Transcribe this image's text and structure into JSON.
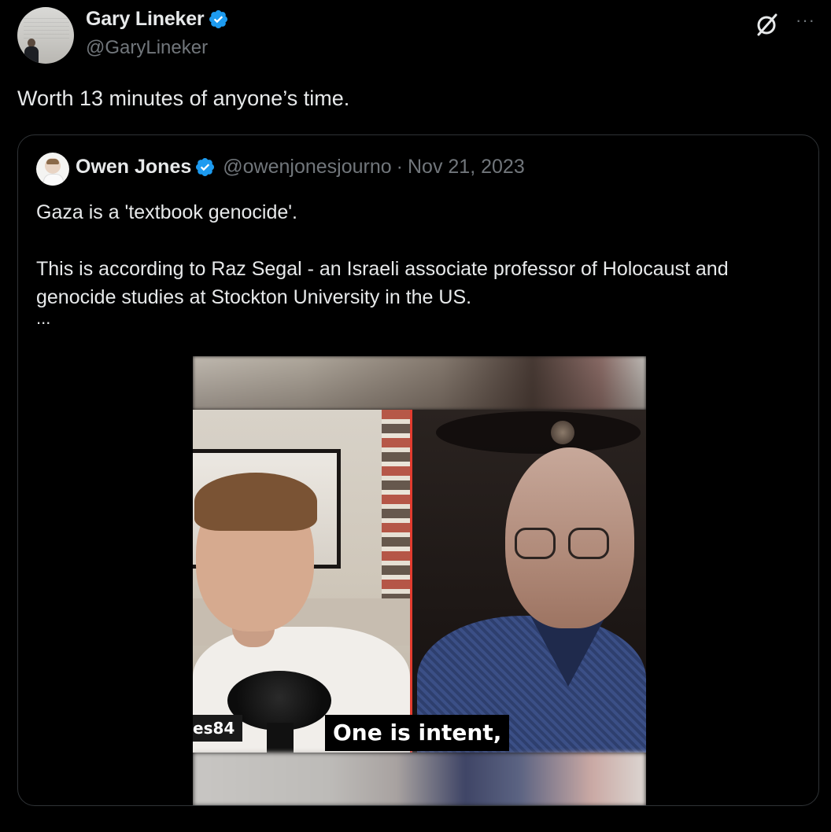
{
  "author": {
    "display_name": "Gary Lineker",
    "handle": "@GaryLineker",
    "verified": true
  },
  "tweet": {
    "text": "Worth 13 minutes of anyone’s time."
  },
  "header_icons": {
    "grok": "grok-icon",
    "more": "···"
  },
  "quoted_tweet": {
    "display_name": "Owen Jones",
    "handle": "@owenjonesjourno",
    "separator": "·",
    "date": "Nov 21, 2023",
    "verified": true,
    "text_line1": "Gaza is a 'textbook genocide'.",
    "text_para2": "This is according to Raz Segal - an Israeli associate professor of Holocaust and genocide studies at Stockton University in the US.",
    "ellipsis": "...",
    "video": {
      "subtitle": "One is intent,",
      "name_tag": "es84"
    }
  },
  "colors": {
    "background": "#000000",
    "text_primary": "#e7e9ea",
    "text_secondary": "#71767b",
    "verified_blue": "#1d9bf0",
    "border": "#2f3336"
  }
}
